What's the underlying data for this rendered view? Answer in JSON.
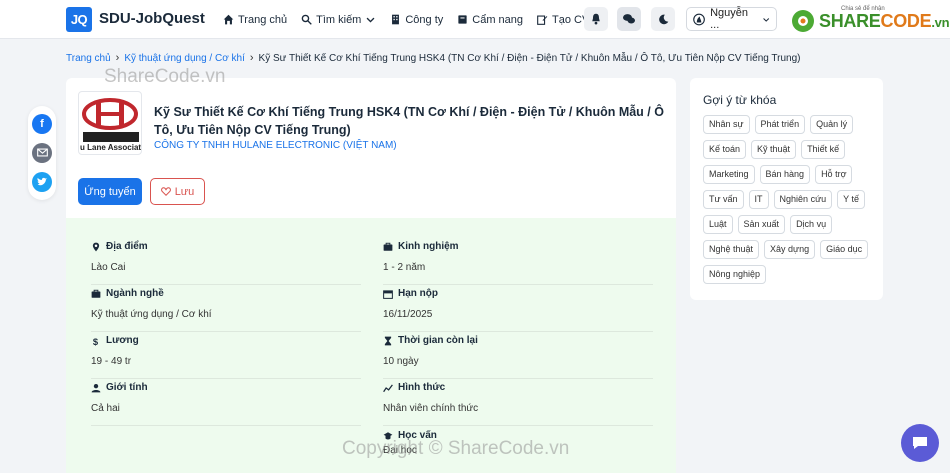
{
  "header": {
    "logo_mark": "JQ",
    "brand": "SDU-JobQuest",
    "nav": [
      {
        "label": "Trang chủ",
        "icon": "home-icon"
      },
      {
        "label": "Tìm kiếm",
        "icon": "search-icon"
      },
      {
        "label": "Công ty",
        "icon": "building-icon"
      },
      {
        "label": "Cẩm nang",
        "icon": "book-icon"
      },
      {
        "label": "Tạo CV",
        "icon": "edit-icon"
      }
    ],
    "user_name": "Nguyễn ...",
    "sharecode_small": "Chia sẻ để nhận",
    "sharecode": {
      "part1": "SHARE",
      "part2": "CODE",
      "tld": ".vn"
    }
  },
  "breadcrumb": {
    "home": "Trang chủ",
    "category": "Kỹ thuật ứng dụng / Cơ khí",
    "current": "Kỹ Sư Thiết Kế Cơ Khí Tiếng Trung HSK4 (TN Cơ Khí / Điện - Điện Tử / Khuôn Mẫu / Ô Tô, Ưu Tiên Nộp CV Tiếng Trung)"
  },
  "job": {
    "title": "Kỹ Sư Thiết Kế Cơ Khí Tiếng Trung HSK4 (TN Cơ Khí / Điện - Điện Tử / Khuôn Mẫu / Ô Tô, Ưu Tiên Nộp CV Tiếng Trung)",
    "company": "CÔNG TY TNHH HULANE ELECTRONIC (VIỆT NAM)",
    "logo_caption": "u Lane Associat",
    "apply_label": "Ứng tuyển",
    "save_label": "Lưu",
    "details": [
      {
        "label": "Địa điểm",
        "value": "Lào Cai",
        "icon": "map-pin-icon"
      },
      {
        "label": "Kinh nghiệm",
        "value": "1 - 2 năm",
        "icon": "briefcase-icon"
      },
      {
        "label": "Ngành nghề",
        "value": "Kỹ thuật ứng dụng / Cơ khí",
        "icon": "briefcase-icon"
      },
      {
        "label": "Hạn nộp",
        "value": "16/11/2025",
        "icon": "calendar-icon"
      },
      {
        "label": "Lương",
        "value": "19 - 49 tr",
        "icon": "dollar-icon"
      },
      {
        "label": "Thời gian còn lại",
        "value": "10 ngày",
        "icon": "hourglass-icon"
      },
      {
        "label": "Giới tính",
        "value": "Cả hai",
        "icon": "user-icon"
      },
      {
        "label": "Hình thức",
        "value": "Nhân viên chính thức",
        "icon": "graph-icon"
      },
      {
        "label": "Học vấn",
        "value": "Đại học",
        "icon": "graduation-cap-icon"
      }
    ]
  },
  "sidebar": {
    "title": "Gợi ý từ khóa",
    "tags": [
      "Nhân sự",
      "Phát triển",
      "Quản lý",
      "Kế toán",
      "Kỹ thuật",
      "Thiết kế",
      "Marketing",
      "Bán hàng",
      "Hỗ trợ",
      "Tư vấn",
      "IT",
      "Nghiên cứu",
      "Y tế",
      "Luật",
      "Sản xuất",
      "Dịch vụ",
      "Nghệ thuật",
      "Xây dựng",
      "Giáo dục",
      "Nông nghiệp"
    ]
  },
  "watermarks": {
    "top": "ShareCode.vn",
    "bottom": "Copyright © ShareCode.vn"
  },
  "colors": {
    "primary": "#1a73e8",
    "info_bg": "#eefbee",
    "save": "#d9534f"
  }
}
